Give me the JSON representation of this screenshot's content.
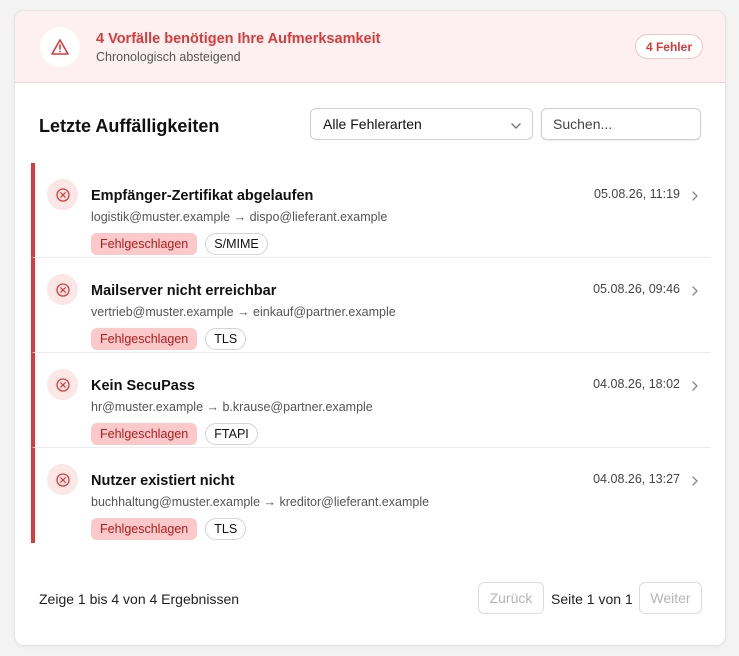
{
  "banner": {
    "title": "4 Vorfälle benötigen Ihre Aufmerksamkeit",
    "subtitle": "Chronologisch absteigend",
    "badge": "4 Fehler",
    "icon": "warning-triangle-icon",
    "accent_color": "#dc3a3a"
  },
  "section": {
    "title": "Letzte Auffälligkeiten",
    "filter_value": "Alle Fehlerarten",
    "search_placeholder": "Suchen..."
  },
  "incidents": [
    {
      "title": "Empfänger-Zertifikat abgelaufen",
      "route": "logistik@muster.example → dispo@lieferant.example",
      "time": "05.08.26, 11:19",
      "status": "Fehlgeschlagen",
      "protocol": "S/MIME"
    },
    {
      "title": "Mailserver nicht erreichbar",
      "route": "vertrieb@muster.example → einkauf@partner.example",
      "time": "05.08.26, 09:46",
      "status": "Fehlgeschlagen",
      "protocol": "TLS"
    },
    {
      "title": "Kein SecuPass",
      "route": "hr@muster.example → b.krause@partner.example",
      "time": "04.08.26, 18:02",
      "status": "Fehlgeschlagen",
      "protocol": "FTAPI"
    },
    {
      "title": "Nutzer existiert nicht",
      "route": "buchhaltung@muster.example → kreditor@lieferant.example",
      "time": "04.08.26, 13:27",
      "status": "Fehlgeschlagen",
      "protocol": "TLS"
    }
  ],
  "pagination": {
    "summary": "Zeige 1 bis 4 von 4 Ergebnissen",
    "prev_label": "Zurück",
    "page_label": "Seite 1 von 1",
    "next_label": "Weiter"
  }
}
